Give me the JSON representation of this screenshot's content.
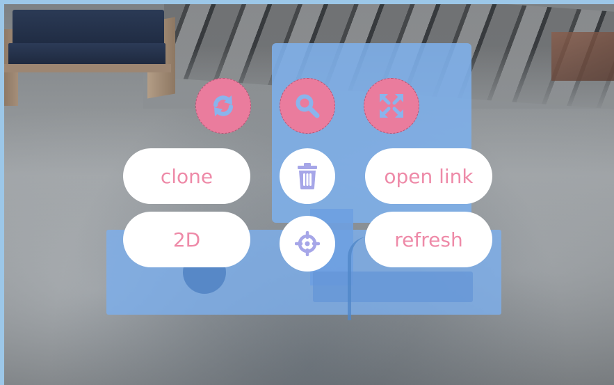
{
  "menu": {
    "top_icons": [
      {
        "name": "refresh-icon",
        "shape": "rotating arrows"
      },
      {
        "name": "search-icon",
        "shape": "magnifier"
      },
      {
        "name": "expand-icon",
        "shape": "four outward arrows"
      }
    ],
    "buttons": {
      "clone": "clone",
      "open_link": "open link",
      "two_d": "2D",
      "refresh": "refresh"
    },
    "center_icons": [
      {
        "name": "trash-icon",
        "shape": "trash can"
      },
      {
        "name": "crosshair-icon",
        "shape": "target reticle"
      }
    ]
  },
  "colors": {
    "frame_border": "#9cc7e8",
    "circle_pink": "#ea7c9d",
    "icon_blue": "#8ab4ec",
    "pill_white": "#ffffff",
    "pill_text": "#ee8aa8",
    "icon_lavender": "#a6a6e8",
    "model_blue": "#7dafeb"
  }
}
